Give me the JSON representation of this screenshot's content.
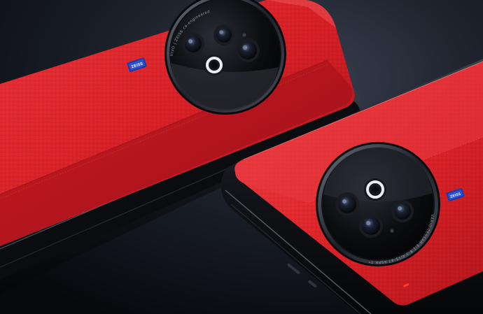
{
  "scene": {
    "background_color": "#0d1016",
    "leather_color": "#d81f24",
    "frame_color": "#15171c",
    "lens_glass_color": "#07080b"
  },
  "phone_left": {
    "badge_text": "ZEISS",
    "lens_ring_text": "VIVO | ZEISS co-engineered"
  },
  "phone_right": {
    "badge_text": "ZEISS",
    "lens_ring_text": "VARIO-TESSAR 1:1.8-2.4/15-47 ASPH T*"
  }
}
